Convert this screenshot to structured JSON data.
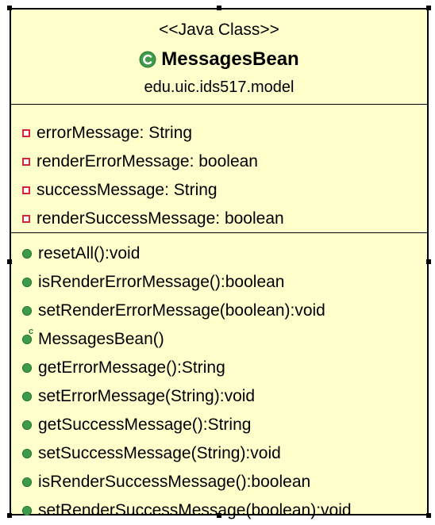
{
  "class_box": {
    "stereotype": "<<Java Class>>",
    "class_name": "MessagesBean",
    "package": "edu.uic.ids517.model",
    "icon": "class-icon",
    "colors": {
      "fill": "#ffffcc",
      "border": "#000000",
      "private_marker": "#d6243a",
      "public_marker": "#3f9a4c"
    }
  },
  "attributes": [
    {
      "text": "errorMessage: String",
      "visibility": "private"
    },
    {
      "text": "renderErrorMessage: boolean",
      "visibility": "private"
    },
    {
      "text": "successMessage: String",
      "visibility": "private"
    },
    {
      "text": "renderSuccessMessage: boolean",
      "visibility": "private"
    }
  ],
  "operations": [
    {
      "text": "resetAll():void",
      "visibility": "public"
    },
    {
      "text": "isRenderErrorMessage():boolean",
      "visibility": "public"
    },
    {
      "text": "setRenderErrorMessage(boolean):void",
      "visibility": "public"
    },
    {
      "text": "MessagesBean()",
      "visibility": "public",
      "constructor": true,
      "constructor_marker": "c"
    },
    {
      "text": "getErrorMessage():String",
      "visibility": "public"
    },
    {
      "text": "setErrorMessage(String):void",
      "visibility": "public"
    },
    {
      "text": "getSuccessMessage():String",
      "visibility": "public"
    },
    {
      "text": "setSuccessMessage(String):void",
      "visibility": "public"
    },
    {
      "text": "isRenderSuccessMessage():boolean",
      "visibility": "public"
    },
    {
      "text": "setRenderSuccessMessage(boolean):void",
      "visibility": "public"
    }
  ]
}
